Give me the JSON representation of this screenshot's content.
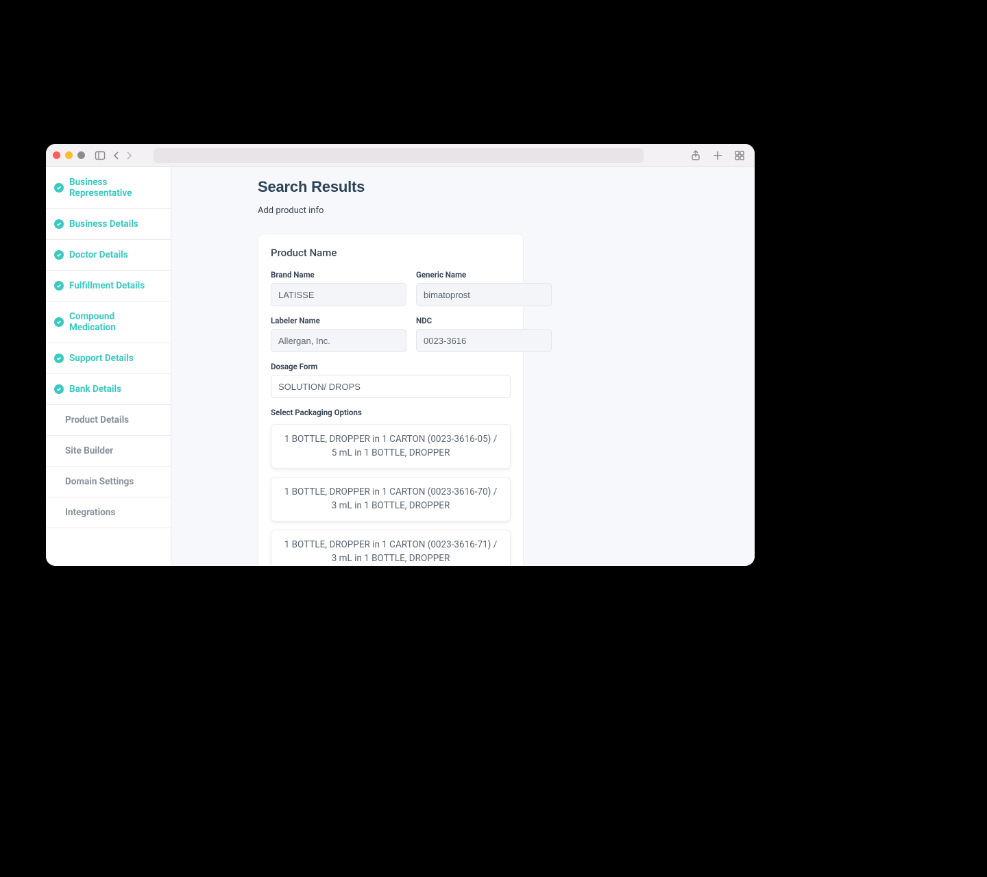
{
  "sidebar": {
    "completed": [
      {
        "label": "Business Representative"
      },
      {
        "label": "Business Details"
      },
      {
        "label": "Doctor Details"
      },
      {
        "label": "Fulfillment Details"
      },
      {
        "label": "Compound Medication"
      },
      {
        "label": "Support Details"
      },
      {
        "label": "Bank Details"
      }
    ],
    "plain": [
      {
        "label": "Product Details"
      },
      {
        "label": "Site Builder"
      },
      {
        "label": "Domain Settings"
      },
      {
        "label": "Integrations"
      }
    ]
  },
  "main": {
    "title": "Search Results",
    "subtitle": "Add product info",
    "card_title": "Product Name",
    "fields": {
      "brand_name_label": "Brand Name",
      "brand_name_value": "LATISSE",
      "generic_name_label": "Generic Name",
      "generic_name_value": "bimatoprost",
      "labeler_name_label": "Labeler Name",
      "labeler_name_value": "Allergan, Inc.",
      "ndc_label": "NDC",
      "ndc_value": "0023-3616",
      "dosage_form_label": "Dosage Form",
      "dosage_form_value": "SOLUTION/ DROPS"
    },
    "packaging_label": "Select Packaging Options",
    "packaging_options": [
      "1 BOTTLE, DROPPER in 1 CARTON (0023-3616-05) / 5 mL in 1 BOTTLE, DROPPER",
      "1 BOTTLE, DROPPER in 1 CARTON (0023-3616-70) / 3 mL in 1 BOTTLE, DROPPER",
      "1 BOTTLE, DROPPER in 1 CARTON (0023-3616-71) / 3 mL in 1 BOTTLE, DROPPER"
    ]
  }
}
